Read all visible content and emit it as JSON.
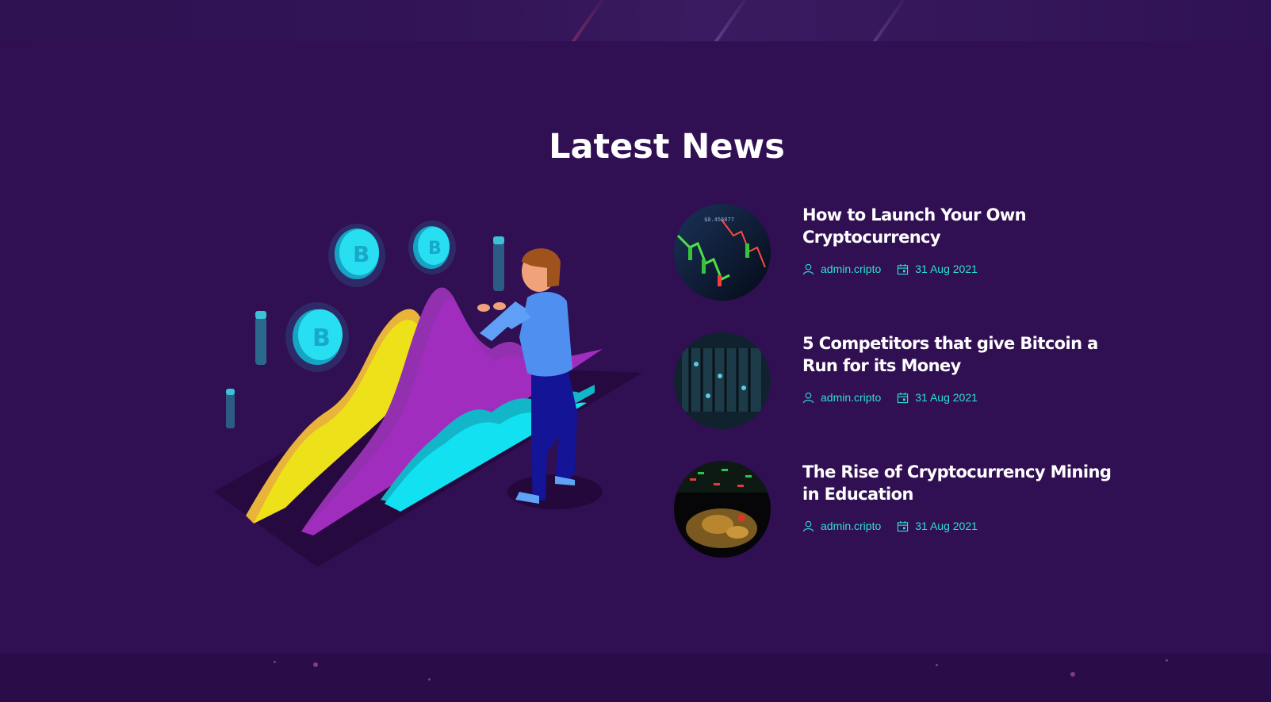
{
  "section": {
    "title": "Latest News"
  },
  "colors": {
    "background": "#300f52",
    "accent": "#2fe0d0",
    "text": "#ffffff"
  },
  "news": [
    {
      "title": "How to Launch Your Own Cryptocurrency",
      "author": "admin.cripto",
      "date": "31 Aug 2021",
      "thumb_icon": "trading-chart-thumbnail"
    },
    {
      "title": "5 Competitors that give Bitcoin a Run for its Money",
      "author": "admin.cripto",
      "date": "31 Aug 2021",
      "thumb_icon": "mining-rig-thumbnail"
    },
    {
      "title": "The Rise of Cryptocurrency Mining in Education",
      "author": "admin.cripto",
      "date": "31 Aug 2021",
      "thumb_icon": "bitcoin-coins-thumbnail"
    }
  ],
  "icons": {
    "author": "user-icon",
    "date": "calendar-icon"
  }
}
